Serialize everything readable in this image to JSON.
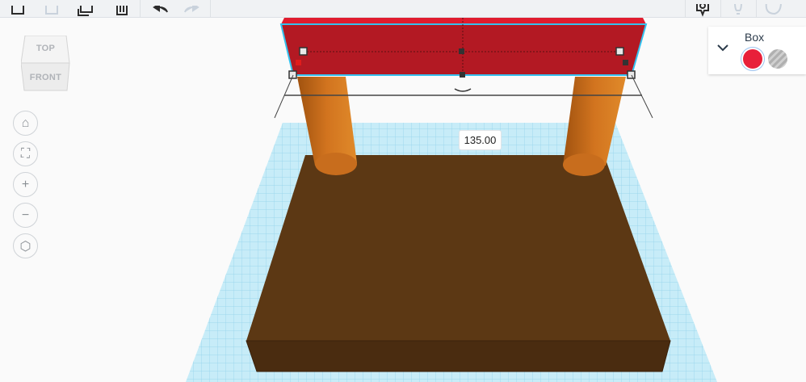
{
  "toolbar": {
    "icons": [
      "copy-icon",
      "paste-icon",
      "duplicate-icon",
      "delete-icon",
      "undo-icon",
      "redo-icon",
      "show-all-icon",
      "light-bulb-icon",
      "speech-bubble-icon"
    ]
  },
  "viewcube": {
    "top_label": "TOP",
    "front_label": "FRONT"
  },
  "nav": {
    "home": "⌂",
    "fit": "⛶",
    "zoom_in": "+",
    "zoom_out": "−",
    "perspective": "⬡"
  },
  "dimension": {
    "value": "135.00"
  },
  "inspector": {
    "title": "Box",
    "solid_color": "#e8203a",
    "hole_label": ""
  },
  "colors": {
    "red_box": "#b31923",
    "legs": "#cf711e",
    "base": "#5c3814",
    "grid": "#a9dcef",
    "selection": "#35c1ee"
  }
}
